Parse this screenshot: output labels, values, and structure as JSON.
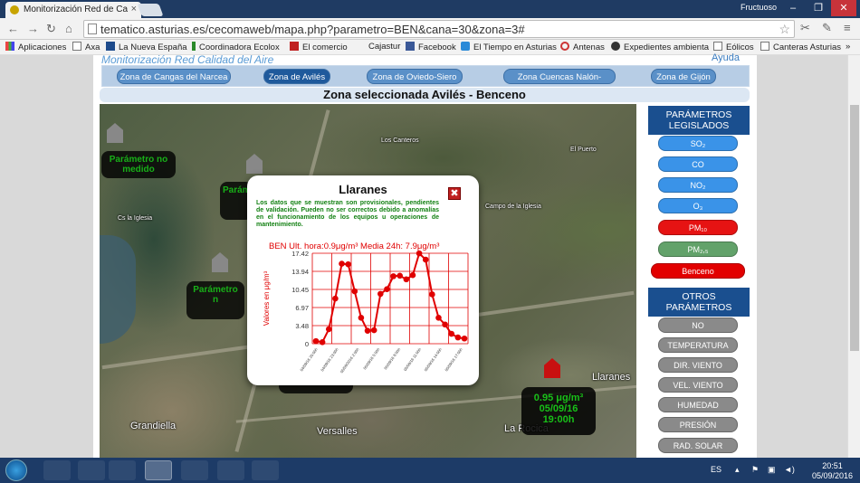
{
  "browser": {
    "tab_title": "Monitorización Red de Ca",
    "user": "Fructuoso",
    "url": "tematico.asturias.es/cecomaweb/mapa.php?parametro=BEN&cana=30&zona=3#",
    "bookmarks": [
      "Aplicaciones",
      "Axa",
      "La Nueva España",
      "Coordinadora Ecolox",
      "El comercio",
      "Cajastur",
      "Facebook",
      "El Tiempo en Asturias",
      "Antenas",
      "Expedientes ambienta",
      "Eólicos",
      "Canteras Asturias"
    ],
    "bookmarks_more": "»"
  },
  "site": {
    "portal_title": "Monitorización Red Calidad del Aire",
    "help": "Ayuda",
    "zones": [
      "Zona de Cangas del Narcea",
      "Zona de Avilés",
      "Zona de Oviedo-Siero",
      "Zona Cuencas Nalón-Caudal",
      "Zona de Gijón"
    ],
    "selected_zone": "Zona seleccionada Avilés - Benceno"
  },
  "map": {
    "labels": [
      "Los Canteros",
      "Campo de la Iglesia",
      "Cs la Iglesia",
      "Llaranes",
      "Grandiella",
      "Versalles",
      "La Rocica"
    ],
    "small_labels": [
      "Los Canteros",
      "El Puerto",
      "Campo de la Iglesia",
      "Cs la Iglesia"
    ],
    "no_param_1": "Parámetro no medido",
    "no_param_2": "Parámetro no medido",
    "no_param_3": "Parámetro no medido",
    "partial_1": "Parámet",
    "partial_2": "Parámetro n",
    "reading_value": "0.95 μg/m³",
    "reading_date": "05/09/16",
    "reading_time": "19:00h"
  },
  "popup": {
    "title": "Llaranes",
    "close": "✖",
    "note": "Los datos que se muestran son provisionales, pendientes de validación. Pueden no ser correctos debido a anomalías en el funcionamiento de los equipos u operaciones de mantenimiento."
  },
  "chart_data": {
    "type": "line",
    "title": "BEN Ult. hora:0.9μg/m³ Media 24h: 7.9μg/m³",
    "ylabel": "Valores en μg/m³",
    "xlabel": "",
    "ylim": [
      0,
      17.42
    ],
    "yticks": [
      "0",
      "3.48",
      "6.97",
      "10.45",
      "13.94",
      "17.42"
    ],
    "xticks": [
      "04/09/16 20:00h",
      "04/09/16 23:00h",
      "05/09/2016 2:00h",
      "05/09/16 5:00h",
      "05/09/16 8:00h",
      "05/09/16 11:00h",
      "05/09/16 14:00h",
      "05/09/16 17:00h"
    ],
    "color": "#e00000",
    "grid": true,
    "values": [
      0.5,
      0.3,
      2.8,
      8.7,
      15.4,
      15.3,
      10.1,
      5.0,
      2.5,
      2.6,
      9.6,
      10.5,
      13.0,
      13.1,
      12.4,
      13.2,
      17.4,
      16.2,
      9.5,
      5.0,
      3.7,
      1.9,
      1.2,
      1.0
    ]
  },
  "legislated": {
    "header": "PARÁMETROS LEGISLADOS",
    "buttons": [
      {
        "label": "SO₂",
        "color": "#3a93e8"
      },
      {
        "label": "CO",
        "color": "#3a93e8"
      },
      {
        "label": "NO₂",
        "color": "#3a93e8"
      },
      {
        "label": "O₃",
        "color": "#3a93e8"
      },
      {
        "label": "PM₁₀",
        "color": "#e61313"
      },
      {
        "label": "PM₂,₅",
        "color": "#62a26a"
      },
      {
        "label": "Benceno",
        "color": "#e20000"
      }
    ]
  },
  "others": {
    "header": "OTROS PARÁMETROS",
    "buttons": [
      "NO",
      "TEMPERATURA",
      "DIR. VIENTO",
      "VEL. VIENTO",
      "HUMEDAD",
      "PRESIÓN",
      "RAD. SOLAR"
    ]
  },
  "taskbar": {
    "lang": "ES",
    "time": "20:51",
    "date": "05/09/2016"
  }
}
